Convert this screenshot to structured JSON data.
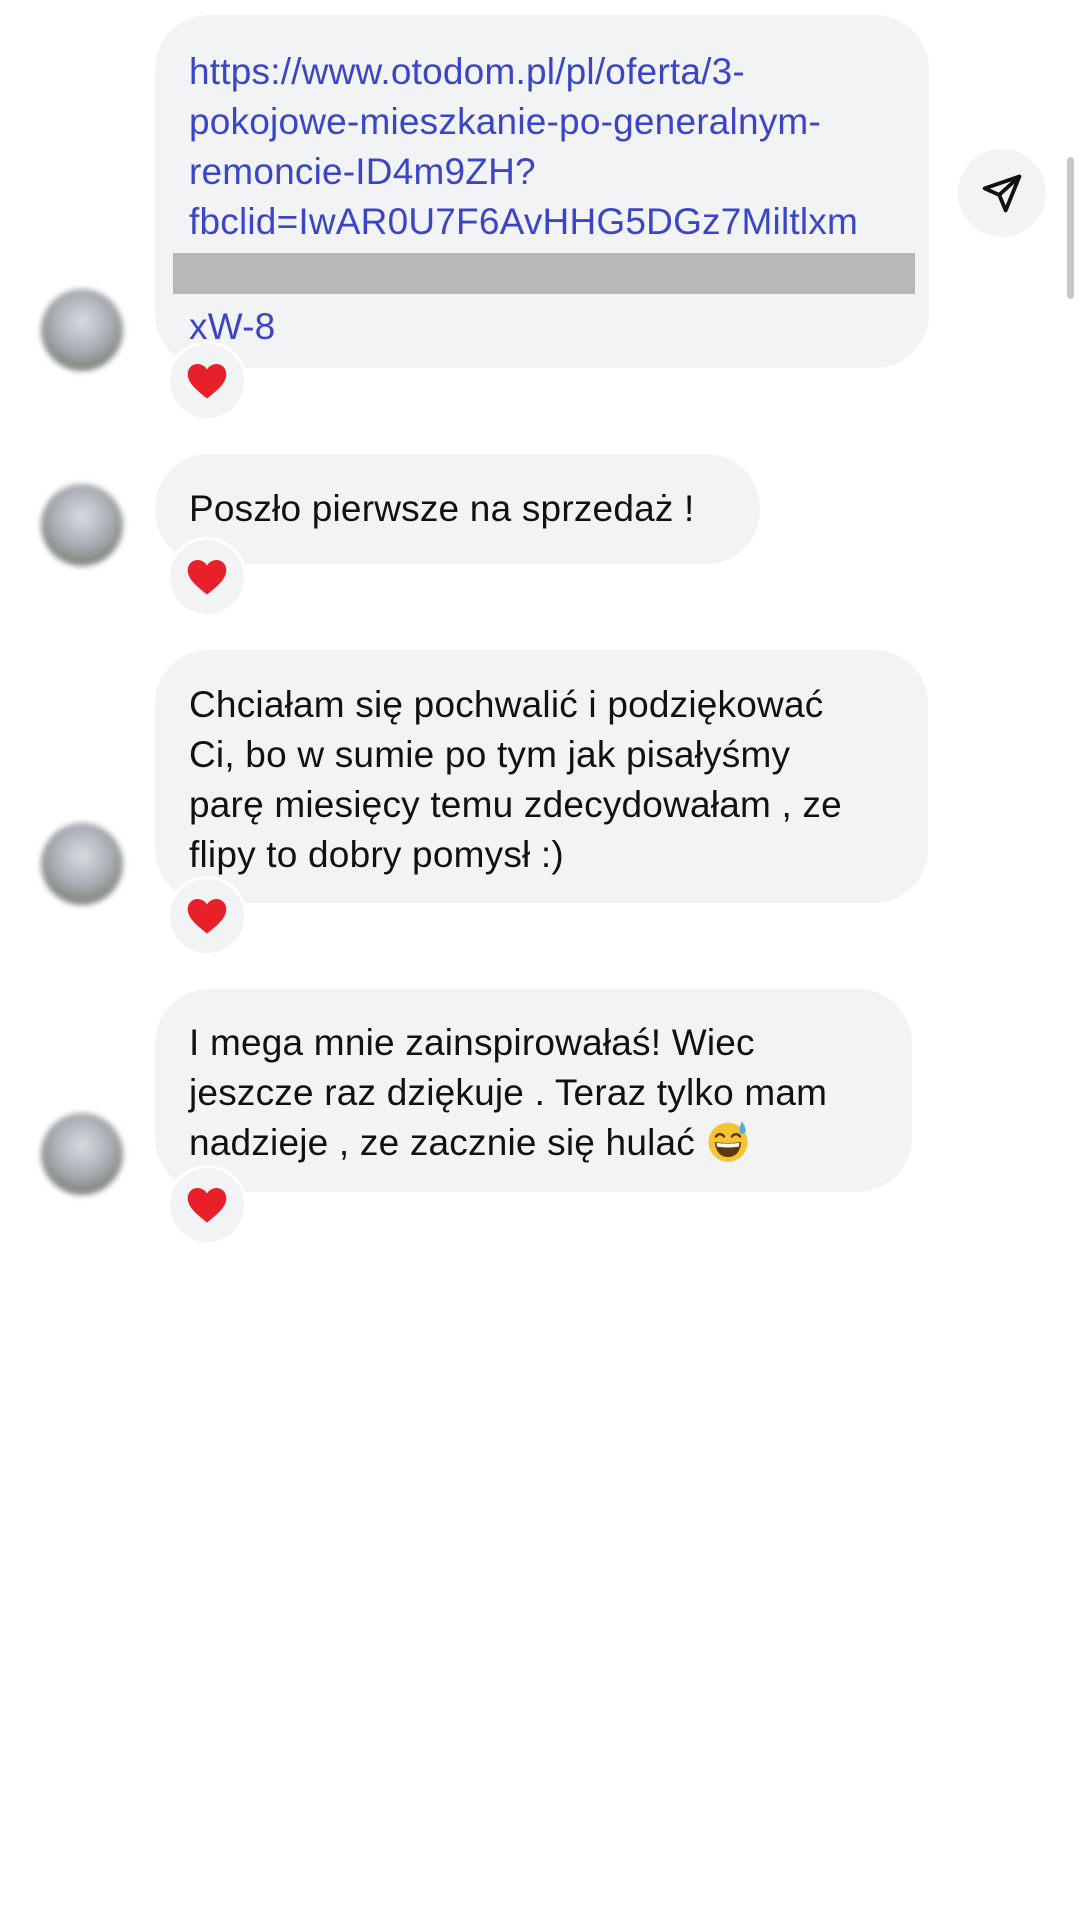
{
  "messages": [
    {
      "type": "link",
      "lines": [
        "https://www.otodom.pl/pl/oferta/3-",
        "pokojowe-mieszkanie-po-generalnym-",
        "remoncie-ID4m9ZH?",
        "fbclid=IwAR0U7F6AvHHG5DGz7Miltlxm",
        "xW-8"
      ],
      "reaction": "heart"
    },
    {
      "type": "text",
      "lines": [
        "Poszło pierwsze na sprzedaż !"
      ],
      "reaction": "heart"
    },
    {
      "type": "text",
      "lines": [
        "Chciałam się pochwalić i podziękować",
        "Ci, bo w sumie po tym jak pisałyśmy",
        "parę miesięcy temu zdecydowałam , ze",
        "flipy to dobry pomysł :)"
      ],
      "reaction": "heart"
    },
    {
      "type": "text",
      "lines": [
        "I mega mnie zainspirowałaś! Wiec",
        "jeszcze raz dziękuje . Teraz tylko mam",
        "nadzieje , ze zacznie się hulać"
      ],
      "trailing_emoji": "grinning-sweat-emoji",
      "reaction": "heart"
    }
  ],
  "icons": {
    "share": "paper-plane-icon",
    "reaction": "red-heart-icon"
  },
  "colors": {
    "bubble_bg": "#f2f3f5",
    "link": "#3b46c6",
    "heart": "#e8202a",
    "redaction": "#b8b8b8"
  }
}
